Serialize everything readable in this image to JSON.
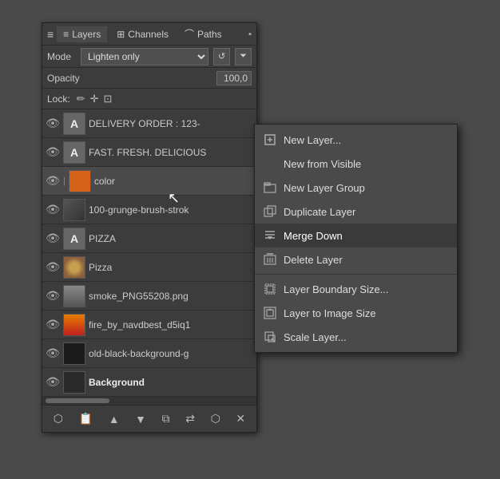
{
  "panel": {
    "title": "Layers",
    "tabs": [
      {
        "label": "Layers",
        "icon": "≡"
      },
      {
        "label": "Channels",
        "icon": "⊞"
      },
      {
        "label": "Paths",
        "icon": "⌒"
      }
    ],
    "mode_label": "Mode",
    "mode_value": "Lighten only",
    "opacity_label": "Opacity",
    "opacity_value": "100,0",
    "lock_label": "Lock:",
    "layers": [
      {
        "name": "DELIVERY ORDER : 123-",
        "type": "text",
        "visible": true
      },
      {
        "name": "FAST. FRESH. DELICIOUS",
        "type": "text",
        "visible": true
      },
      {
        "name": "color",
        "type": "orange",
        "visible": true,
        "chain": true
      },
      {
        "name": "100-grunge-brush-strok",
        "type": "grunge",
        "visible": true
      },
      {
        "name": "PIZZA",
        "type": "text",
        "visible": true
      },
      {
        "name": "Pizza",
        "type": "pizza-img",
        "visible": true
      },
      {
        "name": "smoke_PNG55208.png",
        "type": "smoke-img",
        "visible": true
      },
      {
        "name": "fire_by_navdbest_d5iq1",
        "type": "fire-img",
        "visible": true
      },
      {
        "name": "old-black-background-g",
        "type": "bg-dark",
        "visible": true
      },
      {
        "name": "Background",
        "type": "bg-layer",
        "visible": true,
        "bold": true
      }
    ],
    "footer_buttons": [
      "⬡",
      "📄",
      "▲",
      "▼",
      "⧉",
      "⇄",
      "⬡",
      "✕"
    ]
  },
  "context_menu": {
    "items": [
      {
        "label": "New Layer...",
        "icon": "☐",
        "type": "item"
      },
      {
        "label": "New from Visible",
        "icon": "",
        "type": "item"
      },
      {
        "label": "New Layer Group",
        "icon": "☐",
        "type": "item"
      },
      {
        "label": "Duplicate Layer",
        "icon": "☐",
        "type": "item"
      },
      {
        "label": "Merge Down",
        "icon": "≡",
        "type": "item",
        "highlighted": true
      },
      {
        "label": "Delete Layer",
        "icon": "✕",
        "type": "item"
      },
      {
        "type": "separator"
      },
      {
        "label": "Layer Boundary Size...",
        "icon": "☐",
        "type": "item"
      },
      {
        "label": "Layer to Image Size",
        "icon": "☐",
        "type": "item"
      },
      {
        "label": "Scale Layer...",
        "icon": "☐",
        "type": "item"
      }
    ]
  }
}
